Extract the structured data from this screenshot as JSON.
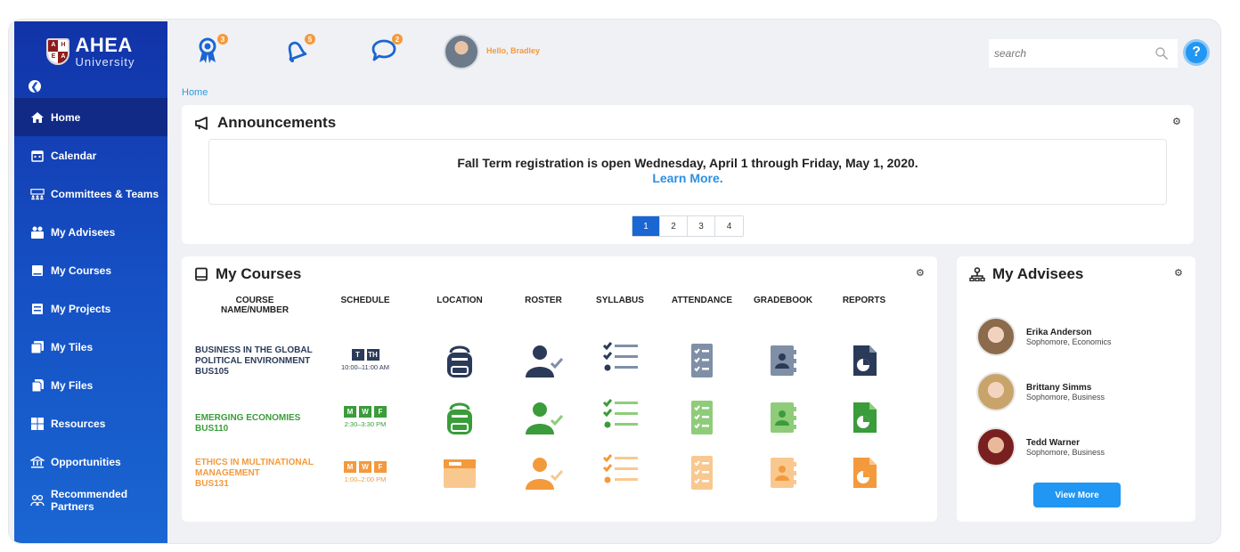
{
  "brand": {
    "name": "AHEA",
    "sub": "University",
    "shield_letters": [
      "A",
      "H",
      "E",
      "A"
    ]
  },
  "sidebar": {
    "items": [
      {
        "label": "Home",
        "icon": "home-icon",
        "active": true
      },
      {
        "label": "Calendar",
        "icon": "calendar-icon"
      },
      {
        "label": "Committees & Teams",
        "icon": "team-icon"
      },
      {
        "label": "My Advisees",
        "icon": "advisees-icon"
      },
      {
        "label": "My Courses",
        "icon": "course-icon"
      },
      {
        "label": "My Projects",
        "icon": "project-icon"
      },
      {
        "label": "My Tiles",
        "icon": "tiles-icon"
      },
      {
        "label": "My Files",
        "icon": "files-icon"
      },
      {
        "label": "Resources",
        "icon": "resources-icon"
      },
      {
        "label": "Opportunities",
        "icon": "opportunities-icon"
      },
      {
        "label": "Recommended Partners",
        "icon": "partners-icon"
      }
    ]
  },
  "topbar": {
    "badges": {
      "awards": "3",
      "notifications": "5",
      "messages": "2"
    },
    "greeting": "Hello, Bradley",
    "search_placeholder": "search",
    "help_label": "?"
  },
  "breadcrumb": "Home",
  "announcements": {
    "title": "Announcements",
    "text": "Fall Term registration is open Wednesday, April 1 through Friday, May 1, 2020.",
    "link": "Learn More.",
    "pages": [
      "1",
      "2",
      "3",
      "4"
    ],
    "active_page": "1"
  },
  "courses": {
    "title": "My Courses",
    "headers": [
      "COURSE NAME/NUMBER",
      "SCHEDULE",
      "LOCATION",
      "ROSTER",
      "SYLLABUS",
      "ATTENDANCE",
      "GRADEBOOK",
      "REPORTS"
    ],
    "rows": [
      {
        "name": "BUSINESS IN THE GLOBAL\nPOLITICAL ENVIRONMENT\nBUS105",
        "days": [
          "T",
          "TH"
        ],
        "time": "10:00–11:00 AM",
        "color": "#2b3a59",
        "light": "#7f8fa6"
      },
      {
        "name": "EMERGING ECONOMIES\nBUS110",
        "days": [
          "M",
          "W",
          "F"
        ],
        "time": "2:30–3:30 PM",
        "color": "#3a9c3a",
        "light": "#8fcc7a"
      },
      {
        "name": "ETHICS IN MULTINATIONAL\nMANAGEMENT\nBUS131",
        "days": [
          "M",
          "W",
          "F"
        ],
        "time": "1:00–2:00 PM",
        "color": "#f39a3c",
        "light": "#f9c88f"
      }
    ]
  },
  "advisees": {
    "title": "My Advisees",
    "people": [
      {
        "name": "Erika Anderson",
        "info": "Sophomore, Economics"
      },
      {
        "name": "Brittany Simms",
        "info": "Sophomore, Business"
      },
      {
        "name": "Tedd Warner",
        "info": "Sophomore, Business"
      }
    ],
    "view_more": "View More"
  },
  "colors": {
    "sidebar": "#1550c4",
    "accent": "#2196f3",
    "orange": "#f39a3c",
    "green": "#3a9c3a",
    "navy": "#2b3a59"
  }
}
